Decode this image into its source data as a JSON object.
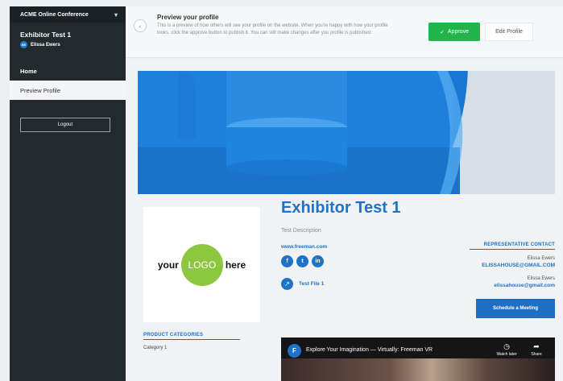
{
  "sidebar": {
    "conference": "ACME Online Conference",
    "exhibitor_name": "Exhibitor Test 1",
    "user_initials": "EE",
    "user_name": "Elissa Ewers",
    "nav": [
      {
        "label": "Home"
      },
      {
        "label": "Preview Profile"
      }
    ],
    "logout": "Logout"
  },
  "topbar": {
    "title": "Preview your profile",
    "description": "This is a preview of how others will see your profile on the website. When you're happy with how your profile looks, click the approve button to publish it. You can still make changes after you profile is published.",
    "approve": "Approve",
    "edit": "Edit Profile"
  },
  "profile": {
    "logo_left": "your",
    "logo_mid": "LOGO",
    "logo_right": "here",
    "product_categories_title": "PRODUCT CATEGORIES",
    "category": "Category 1",
    "title": "Exhibitor Test 1",
    "description": "Test Description",
    "website": "www.freeman.com",
    "file": "Test File 1",
    "rep_title": "REPRESENTATIVE CONTACT",
    "contacts": [
      {
        "name": "Elissa Ewers",
        "email": "ELISSAHOUSE@GMAIL.COM"
      },
      {
        "name": "Elissa Ewers",
        "email": "elissahouse@gmail.com"
      }
    ],
    "meeting": "Schedule a Meeting"
  },
  "video": {
    "logo": "F",
    "title": "Explore Your Imagination — Virtually: Freeman VR",
    "watch_later": "Watch later",
    "share": "Share"
  },
  "colors": {
    "accent": "#1e73c8",
    "approve": "#20b44b",
    "sidebar": "#232a2e",
    "logo_green": "#8dc63f"
  }
}
